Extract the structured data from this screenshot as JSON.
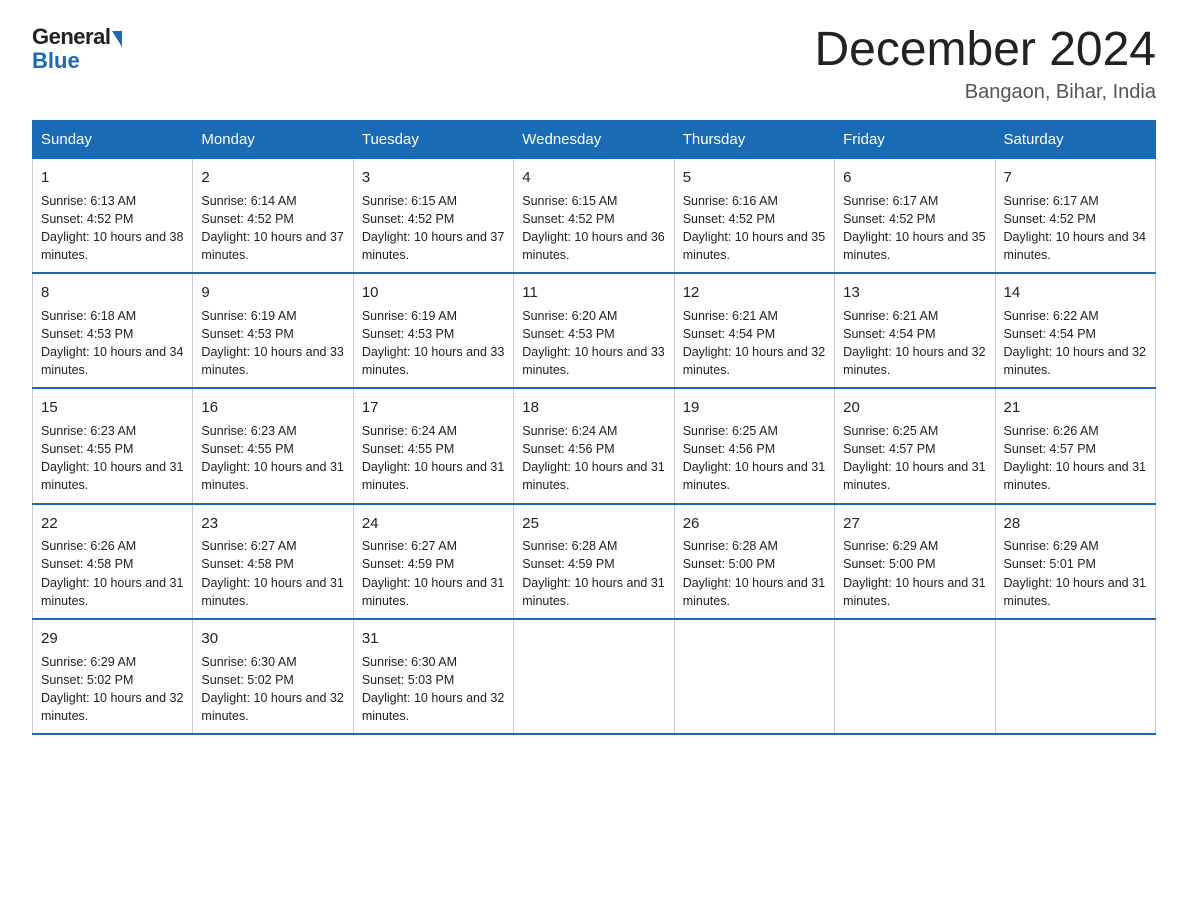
{
  "logo": {
    "general": "General",
    "blue": "Blue"
  },
  "title": "December 2024",
  "location": "Bangaon, Bihar, India",
  "days_of_week": [
    "Sunday",
    "Monday",
    "Tuesday",
    "Wednesday",
    "Thursday",
    "Friday",
    "Saturday"
  ],
  "weeks": [
    [
      {
        "day": "1",
        "sunrise": "6:13 AM",
        "sunset": "4:52 PM",
        "daylight": "10 hours and 38 minutes."
      },
      {
        "day": "2",
        "sunrise": "6:14 AM",
        "sunset": "4:52 PM",
        "daylight": "10 hours and 37 minutes."
      },
      {
        "day": "3",
        "sunrise": "6:15 AM",
        "sunset": "4:52 PM",
        "daylight": "10 hours and 37 minutes."
      },
      {
        "day": "4",
        "sunrise": "6:15 AM",
        "sunset": "4:52 PM",
        "daylight": "10 hours and 36 minutes."
      },
      {
        "day": "5",
        "sunrise": "6:16 AM",
        "sunset": "4:52 PM",
        "daylight": "10 hours and 35 minutes."
      },
      {
        "day": "6",
        "sunrise": "6:17 AM",
        "sunset": "4:52 PM",
        "daylight": "10 hours and 35 minutes."
      },
      {
        "day": "7",
        "sunrise": "6:17 AM",
        "sunset": "4:52 PM",
        "daylight": "10 hours and 34 minutes."
      }
    ],
    [
      {
        "day": "8",
        "sunrise": "6:18 AM",
        "sunset": "4:53 PM",
        "daylight": "10 hours and 34 minutes."
      },
      {
        "day": "9",
        "sunrise": "6:19 AM",
        "sunset": "4:53 PM",
        "daylight": "10 hours and 33 minutes."
      },
      {
        "day": "10",
        "sunrise": "6:19 AM",
        "sunset": "4:53 PM",
        "daylight": "10 hours and 33 minutes."
      },
      {
        "day": "11",
        "sunrise": "6:20 AM",
        "sunset": "4:53 PM",
        "daylight": "10 hours and 33 minutes."
      },
      {
        "day": "12",
        "sunrise": "6:21 AM",
        "sunset": "4:54 PM",
        "daylight": "10 hours and 32 minutes."
      },
      {
        "day": "13",
        "sunrise": "6:21 AM",
        "sunset": "4:54 PM",
        "daylight": "10 hours and 32 minutes."
      },
      {
        "day": "14",
        "sunrise": "6:22 AM",
        "sunset": "4:54 PM",
        "daylight": "10 hours and 32 minutes."
      }
    ],
    [
      {
        "day": "15",
        "sunrise": "6:23 AM",
        "sunset": "4:55 PM",
        "daylight": "10 hours and 31 minutes."
      },
      {
        "day": "16",
        "sunrise": "6:23 AM",
        "sunset": "4:55 PM",
        "daylight": "10 hours and 31 minutes."
      },
      {
        "day": "17",
        "sunrise": "6:24 AM",
        "sunset": "4:55 PM",
        "daylight": "10 hours and 31 minutes."
      },
      {
        "day": "18",
        "sunrise": "6:24 AM",
        "sunset": "4:56 PM",
        "daylight": "10 hours and 31 minutes."
      },
      {
        "day": "19",
        "sunrise": "6:25 AM",
        "sunset": "4:56 PM",
        "daylight": "10 hours and 31 minutes."
      },
      {
        "day": "20",
        "sunrise": "6:25 AM",
        "sunset": "4:57 PM",
        "daylight": "10 hours and 31 minutes."
      },
      {
        "day": "21",
        "sunrise": "6:26 AM",
        "sunset": "4:57 PM",
        "daylight": "10 hours and 31 minutes."
      }
    ],
    [
      {
        "day": "22",
        "sunrise": "6:26 AM",
        "sunset": "4:58 PM",
        "daylight": "10 hours and 31 minutes."
      },
      {
        "day": "23",
        "sunrise": "6:27 AM",
        "sunset": "4:58 PM",
        "daylight": "10 hours and 31 minutes."
      },
      {
        "day": "24",
        "sunrise": "6:27 AM",
        "sunset": "4:59 PM",
        "daylight": "10 hours and 31 minutes."
      },
      {
        "day": "25",
        "sunrise": "6:28 AM",
        "sunset": "4:59 PM",
        "daylight": "10 hours and 31 minutes."
      },
      {
        "day": "26",
        "sunrise": "6:28 AM",
        "sunset": "5:00 PM",
        "daylight": "10 hours and 31 minutes."
      },
      {
        "day": "27",
        "sunrise": "6:29 AM",
        "sunset": "5:00 PM",
        "daylight": "10 hours and 31 minutes."
      },
      {
        "day": "28",
        "sunrise": "6:29 AM",
        "sunset": "5:01 PM",
        "daylight": "10 hours and 31 minutes."
      }
    ],
    [
      {
        "day": "29",
        "sunrise": "6:29 AM",
        "sunset": "5:02 PM",
        "daylight": "10 hours and 32 minutes."
      },
      {
        "day": "30",
        "sunrise": "6:30 AM",
        "sunset": "5:02 PM",
        "daylight": "10 hours and 32 minutes."
      },
      {
        "day": "31",
        "sunrise": "6:30 AM",
        "sunset": "5:03 PM",
        "daylight": "10 hours and 32 minutes."
      },
      null,
      null,
      null,
      null
    ]
  ],
  "labels": {
    "sunrise": "Sunrise: ",
    "sunset": "Sunset: ",
    "daylight": "Daylight: "
  }
}
